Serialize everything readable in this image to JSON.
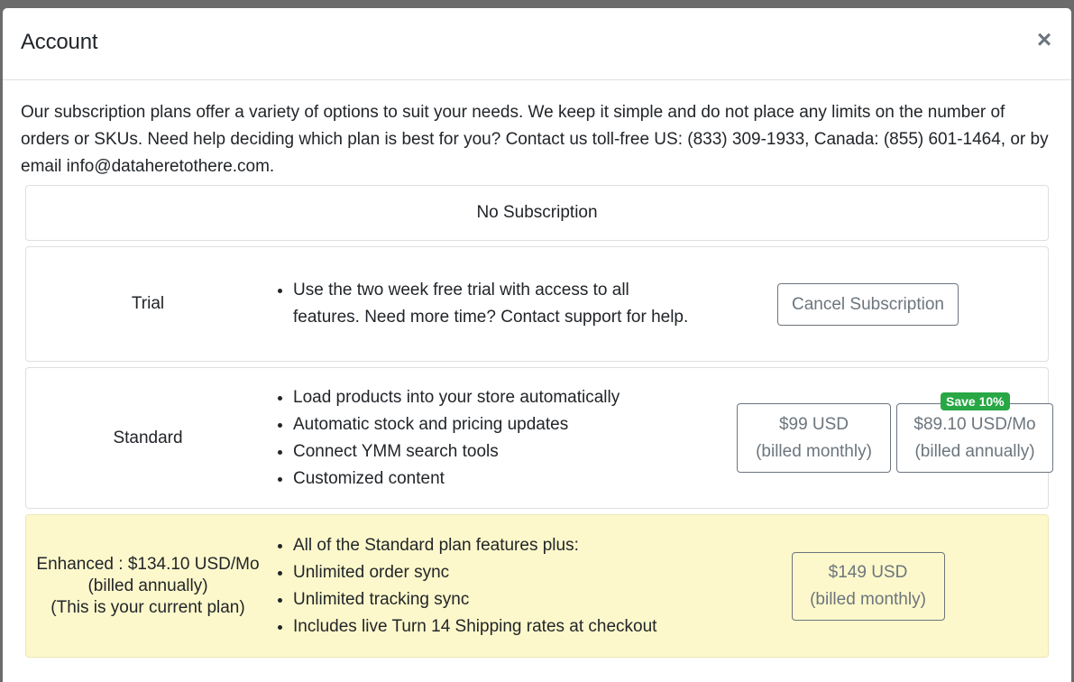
{
  "modal": {
    "title": "Account",
    "close_label": "×"
  },
  "intro": "Our subscription plans offer a variety of options to suit your needs. We keep it simple and do not place any limits on the number of orders or SKUs. Need help deciding which plan is best for you? Contact us toll-free US: (833) 309-1933, Canada: (855) 601-1464, or by email info@dataheretothere.com.",
  "no_subscription": {
    "label": "No Subscription"
  },
  "plans": {
    "trial": {
      "name": "Trial",
      "features": [
        "Use the two week free trial with access to all features. Need more time? Contact support for help."
      ],
      "cancel_label": "Cancel Subscription"
    },
    "standard": {
      "name": "Standard",
      "features": [
        "Load products into your store automatically",
        "Automatic stock and pricing updates",
        "Connect YMM search tools",
        "Customized content"
      ],
      "monthly": {
        "price": "$99 USD",
        "period": "(billed monthly)"
      },
      "annual": {
        "price": "$89.10 USD/Mo",
        "period": "(billed annually)",
        "badge": "Save 10%"
      }
    },
    "enhanced": {
      "name_line1": "Enhanced : $134.10 USD/Mo",
      "name_line2": "(billed annually)",
      "name_line3": "(This is your current plan)",
      "features": [
        "All of the Standard plan features plus:",
        "Unlimited order sync",
        "Unlimited tracking sync",
        "Includes live Turn 14 Shipping rates at checkout"
      ],
      "monthly": {
        "price": "$149 USD",
        "period": "(billed monthly)"
      }
    }
  },
  "colors": {
    "badge_green": "#28a745",
    "current_plan_bg": "#fdf8cb",
    "outline_gray": "#6c757d"
  }
}
